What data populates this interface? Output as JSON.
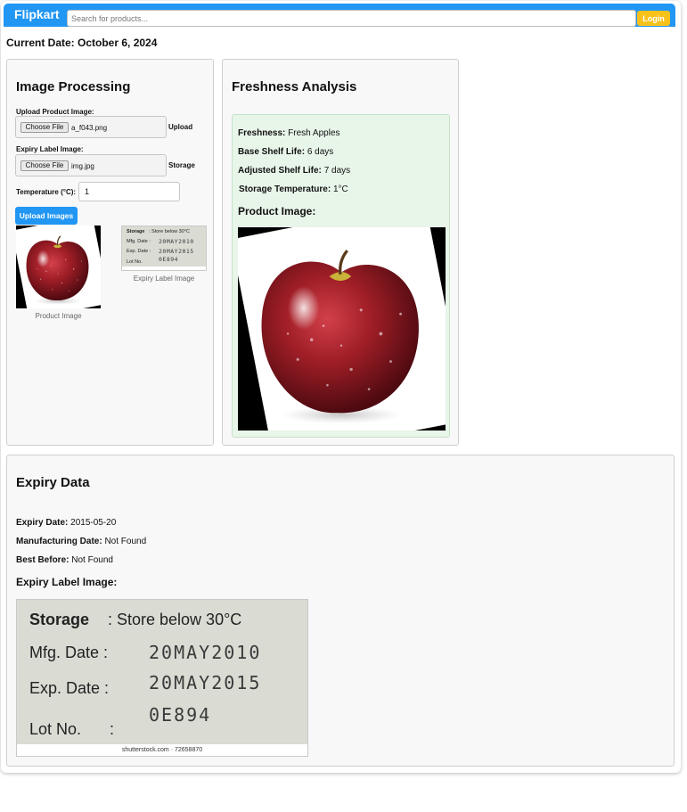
{
  "header": {
    "brand": "Flipkart",
    "search_placeholder": "Search for products...",
    "login_label": "Login"
  },
  "current_date": "Current Date: October 6, 2024",
  "image_processing": {
    "title": "Image Processing",
    "product_image_label": "Upload Product Image:",
    "choose_file_label": "Choose File",
    "product_file_name": "a_f043.png",
    "product_side_note": "Upload",
    "expiry_label_label": "Expiry Label Image:",
    "expiry_file_name": "img.jpg",
    "expiry_side_note": "Storage",
    "temperature_label": "Temperature (°C):",
    "temperature_value": "1",
    "upload_button": "Upload Images",
    "product_caption": "Product Image",
    "expiry_caption": "Expiry Label Image"
  },
  "freshness": {
    "title": "Freshness Analysis",
    "freshness_key": "Freshness:",
    "freshness_value": "Fresh Apples",
    "base_shelf_key": "Base Shelf Life:",
    "base_shelf_value": "6 days",
    "adjusted_shelf_key": "Adjusted Shelf Life:",
    "adjusted_shelf_value": "7 days",
    "storage_temp_key": "Storage Temperature:",
    "storage_temp_value": "1°C",
    "product_image_heading": "Product Image:"
  },
  "expiry": {
    "title": "Expiry Data",
    "expiry_date_key": "Expiry Date:",
    "expiry_date_value": "2015-05-20",
    "mfg_date_key": "Manufacturing Date:",
    "mfg_date_value": "Not Found",
    "best_before_key": "Best Before:",
    "best_before_value": "Not Found",
    "label_image_heading": "Expiry Label Image:"
  },
  "label_image": {
    "storage_key": "Storage",
    "storage_value": ": Store below 30°C",
    "mfg_key": "Mfg. Date :",
    "mfg_value": "20MAY2010",
    "exp_key": "Exp. Date :",
    "exp_value": "20MAY2015",
    "lot_key": "Lot No.",
    "lot_colon": ":",
    "lot_value": "0E894",
    "footer": "shutterstock.com · 72658870"
  },
  "colors": {
    "header_blue": "#2196f3",
    "login_yellow": "#f9c21b",
    "fresh_green": "#e8f5e9",
    "apple_red": "#8e1a22"
  }
}
